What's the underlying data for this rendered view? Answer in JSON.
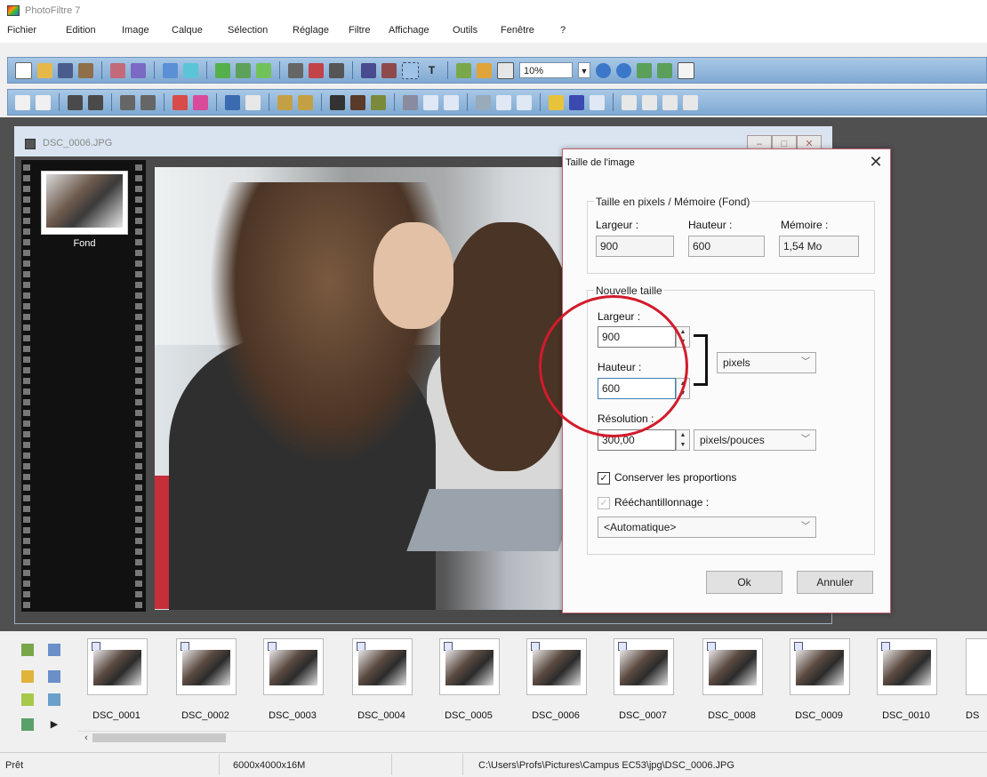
{
  "app": {
    "title": "PhotoFiltre 7"
  },
  "menu": [
    "Fichier",
    "Edition",
    "Image",
    "Calque",
    "Sélection",
    "Réglage",
    "Filtre",
    "Affichage",
    "Outils",
    "Fenêtre",
    "?"
  ],
  "toolbar": {
    "zoom": "10%"
  },
  "document": {
    "title": "DSC_0006.JPG",
    "layer": "Fond"
  },
  "dialog": {
    "title": "Taille de l'image",
    "pixel_group_label": "Taille en pixels / Mémoire (Fond)",
    "width_label": "Largeur :",
    "height_label": "Hauteur :",
    "memory_label": "Mémoire :",
    "width_value": "900",
    "height_value": "600",
    "memory_value": "1,54 Mo",
    "new_size_label": "Nouvelle taille",
    "new_width_label": "Largeur :",
    "new_width_value": "900",
    "new_height_label": "Hauteur :",
    "new_height_value": "600",
    "unit": "pixels",
    "resolution_label": "Résolution :",
    "resolution_value": "300,00",
    "resolution_unit": "pixels/pouces",
    "keep_proportions": "Conserver les proportions",
    "resample": "Rééchantillonnage :",
    "resample_mode": "<Automatique>",
    "ok": "Ok",
    "cancel": "Annuler"
  },
  "thumbnails": [
    "DSC_0001",
    "DSC_0002",
    "DSC_0003",
    "DSC_0004",
    "DSC_0005",
    "DSC_0006",
    "DSC_0007",
    "DSC_0008",
    "DSC_0009",
    "DSC_0010",
    "DS"
  ],
  "status": {
    "state": "Prêt",
    "dimensions": "6000x4000x16M",
    "path": "C:\\Users\\Profs\\Pictures\\Campus EC53\\jpg\\DSC_0006.JPG"
  }
}
